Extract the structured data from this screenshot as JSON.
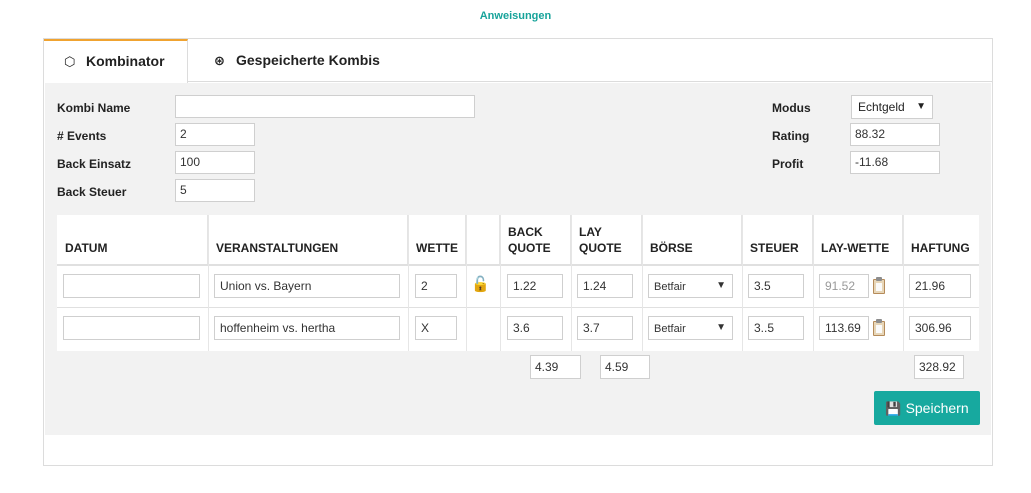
{
  "top_link": "Anweisungen",
  "tabs": [
    {
      "label": "Kombinator",
      "icon": "codepen-icon"
    },
    {
      "label": "Gespeicherte Kombis",
      "icon": "dribbble-icon"
    }
  ],
  "form": {
    "kombi_name_label": "Kombi Name",
    "kombi_name_value": "",
    "events_label": "# Events",
    "events_value": "2",
    "back_einsatz_label": "Back Einsatz",
    "back_einsatz_value": "100",
    "back_steuer_label": "Back Steuer",
    "back_steuer_value": "5",
    "modus_label": "Modus",
    "modus_value": "Echtgeld",
    "rating_label": "Rating",
    "rating_value": "88.32",
    "profit_label": "Profit",
    "profit_value": "-11.68"
  },
  "table": {
    "headers": {
      "datum": "DATUM",
      "veranstaltungen": "VERANSTALTUNGEN",
      "wette": "WETTE",
      "back_quote_1": "BACK",
      "back_quote_2": "QUOTE",
      "lay_quote_1": "LAY",
      "lay_quote_2": "QUOTE",
      "boerse": "BÖRSE",
      "steuer": "STEUER",
      "lay_wette": "LAY-WETTE",
      "haftung": "HAFTUNG"
    },
    "rows": [
      {
        "datum": "",
        "event": "Union vs. Bayern",
        "wette": "2",
        "back_quote": "1.22",
        "lay_quote": "1.24",
        "boerse": "Betfair",
        "steuer": "3.5",
        "lay_wette": "91.52",
        "haftung": "21.96"
      },
      {
        "datum": "",
        "event": "hoffenheim vs. hertha",
        "wette": "X",
        "back_quote": "3.6",
        "lay_quote": "3.7",
        "boerse": "Betfair",
        "steuer": "3..5",
        "lay_wette": "113.69",
        "haftung": "306.96"
      }
    ],
    "totals": {
      "back_quote": "4.39",
      "lay_quote": "4.59",
      "haftung": "328.92"
    }
  },
  "save_button": {
    "label": "Speichern",
    "icon": "floppy-disk-icon"
  },
  "colors": {
    "accent": "#17a99f",
    "tab_active": "#f0a330",
    "panel_bg": "#f2f2f2"
  }
}
